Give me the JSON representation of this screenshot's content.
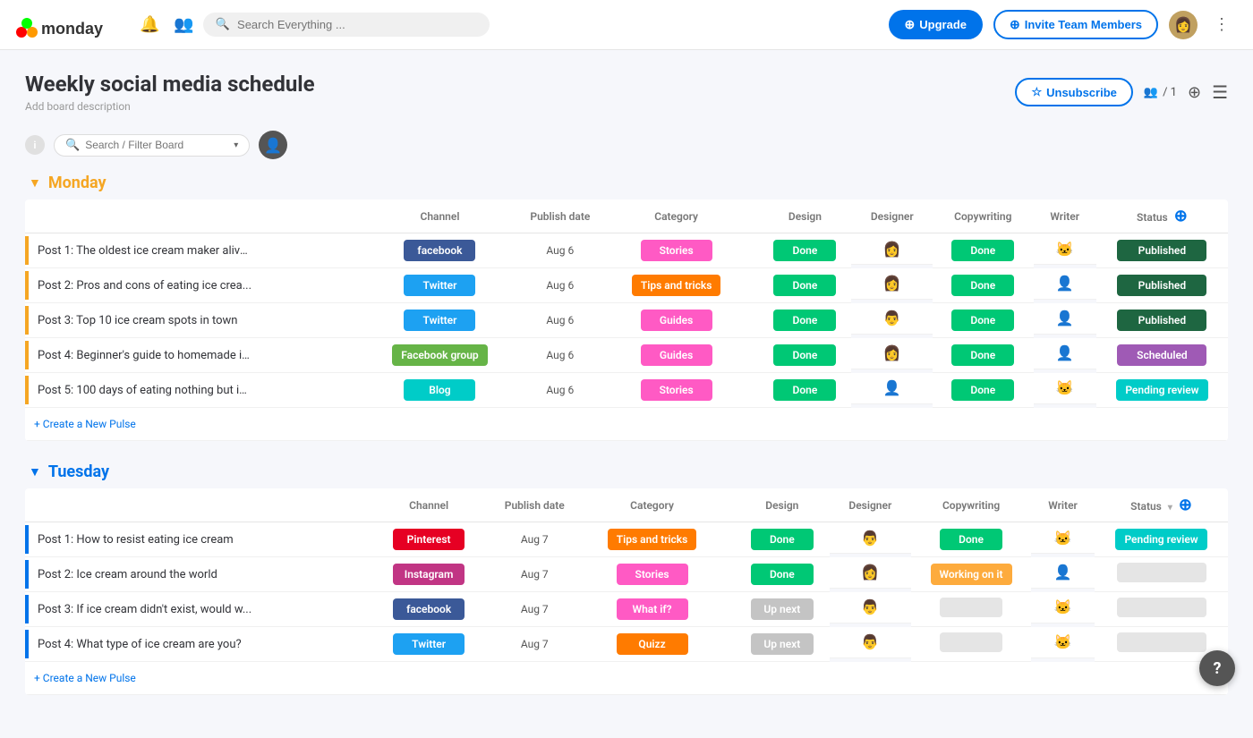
{
  "app": {
    "name": "monday",
    "search_placeholder": "Search Everything ..."
  },
  "nav": {
    "upgrade_label": "Upgrade",
    "invite_label": "Invite Team Members"
  },
  "board": {
    "title": "Weekly social media schedule",
    "description": "Add board description",
    "unsubscribe_label": "Unsubscribe",
    "members_count": "/ 1"
  },
  "toolbar": {
    "filter_placeholder": "Search / Filter Board"
  },
  "columns": {
    "item": "",
    "channel": "Channel",
    "publish_date": "Publish date",
    "category": "Category",
    "dot": ".",
    "design": "Design",
    "designer": "Designer",
    "copywriting": "Copywriting",
    "writer": "Writer",
    "status": "Status"
  },
  "groups": [
    {
      "id": "monday",
      "title": "Monday",
      "color": "#f5a623",
      "rows": [
        {
          "title": "Post 1: The oldest ice cream maker alive...",
          "channel": "facebook",
          "channel_color": "#3b5998",
          "publish_date": "Aug 6",
          "category": "Stories",
          "category_color": "#ff5ac4",
          "design": "Done",
          "design_color": "#00c875",
          "designer_emoji": "👩",
          "copywriting": "Done",
          "copywriting_color": "#00c875",
          "writer_emoji": "🐱",
          "status": "Published",
          "status_color": "#1e6641"
        },
        {
          "title": "Post 2: Pros and cons of eating ice crea...",
          "channel": "Twitter",
          "channel_color": "#1da1f2",
          "publish_date": "Aug 6",
          "category": "Tips and tricks",
          "category_color": "#ff7b00",
          "design": "Done",
          "design_color": "#00c875",
          "designer_emoji": "👩",
          "copywriting": "Done",
          "copywriting_color": "#00c875",
          "writer_emoji": "👤",
          "status": "Published",
          "status_color": "#1e6641"
        },
        {
          "title": "Post 3: Top 10 ice cream spots in town",
          "channel": "Twitter",
          "channel_color": "#1da1f2",
          "publish_date": "Aug 6",
          "category": "Guides",
          "category_color": "#ff5ac4",
          "design": "Done",
          "design_color": "#00c875",
          "designer_emoji": "👨",
          "copywriting": "Done",
          "copywriting_color": "#00c875",
          "writer_emoji": "👤",
          "status": "Published",
          "status_color": "#1e6641"
        },
        {
          "title": "Post 4: Beginner's guide to homemade ic...",
          "channel": "Facebook group",
          "channel_color": "#66b447",
          "publish_date": "Aug 6",
          "category": "Guides",
          "category_color": "#ff5ac4",
          "design": "Done",
          "design_color": "#00c875",
          "designer_emoji": "👩",
          "copywriting": "Done",
          "copywriting_color": "#00c875",
          "writer_emoji": "👤",
          "status": "Scheduled",
          "status_color": "#9f5ab5"
        },
        {
          "title": "Post 5: 100 days of eating nothing but ic...",
          "channel": "Blog",
          "channel_color": "#00ccc8",
          "publish_date": "Aug 6",
          "category": "Stories",
          "category_color": "#ff5ac4",
          "design": "Done",
          "design_color": "#00c875",
          "designer_emoji": "👤",
          "copywriting": "Done",
          "copywriting_color": "#00c875",
          "writer_emoji": "🐱",
          "status": "Pending review",
          "status_color": "#00ccc8"
        }
      ],
      "create_pulse": "+ Create a New Pulse"
    },
    {
      "id": "tuesday",
      "title": "Tuesday",
      "color": "#0073ea",
      "rows": [
        {
          "title": "Post 1: How to resist eating ice cream",
          "channel": "Pinterest",
          "channel_color": "#e60023",
          "publish_date": "Aug 7",
          "category": "Tips and tricks",
          "category_color": "#ff7b00",
          "design": "Done",
          "design_color": "#00c875",
          "designer_emoji": "👨",
          "copywriting": "Done",
          "copywriting_color": "#00c875",
          "writer_emoji": "🐱",
          "status": "Pending review",
          "status_color": "#00ccc8"
        },
        {
          "title": "Post 2: Ice cream around the world",
          "channel": "Instagram",
          "channel_color": "#c13584",
          "publish_date": "Aug 7",
          "category": "Stories",
          "category_color": "#ff5ac4",
          "design": "Done",
          "design_color": "#00c875",
          "designer_emoji": "👩",
          "copywriting": "Working on it",
          "copywriting_color": "#fdab3d",
          "writer_emoji": "👤",
          "status": "",
          "status_color": ""
        },
        {
          "title": "Post 3: If ice cream didn't exist, would w...",
          "channel": "facebook",
          "channel_color": "#3b5998",
          "publish_date": "Aug 7",
          "category": "What if?",
          "category_color": "#ff5ac4",
          "design": "Up next",
          "design_color": "#c4c4c4",
          "designer_emoji": "👨",
          "copywriting": "",
          "copywriting_color": "",
          "writer_emoji": "🐱",
          "status": "",
          "status_color": ""
        },
        {
          "title": "Post 4: What type of ice cream are you?",
          "channel": "Twitter",
          "channel_color": "#1da1f2",
          "publish_date": "Aug 7",
          "category": "Quizz",
          "category_color": "#ff7b00",
          "design": "Up next",
          "design_color": "#c4c4c4",
          "designer_emoji": "👨",
          "copywriting": "",
          "copywriting_color": "",
          "writer_emoji": "🐱",
          "status": "",
          "status_color": ""
        }
      ],
      "create_pulse": "+ Create a New Pulse"
    }
  ]
}
